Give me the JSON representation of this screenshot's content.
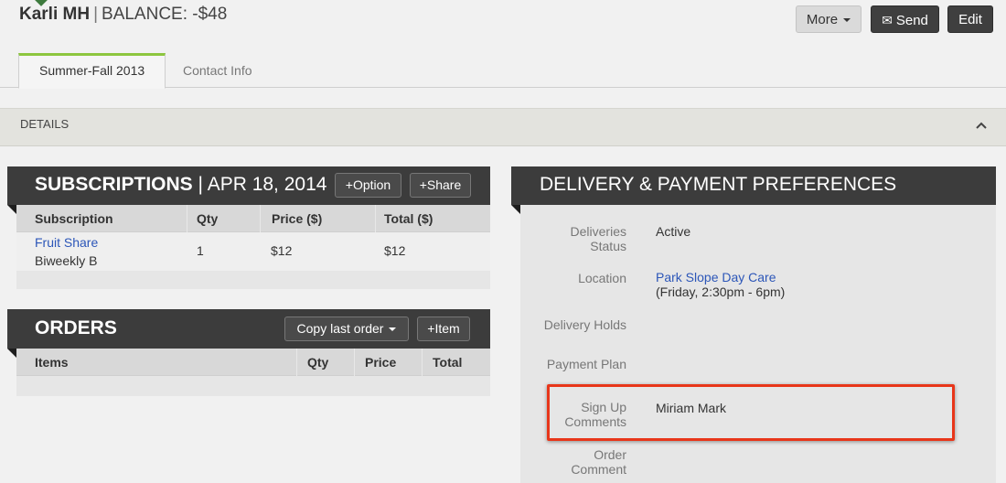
{
  "header": {
    "name": "Karli MH",
    "separator": "|",
    "balance": "BALANCE: -$48",
    "buttons": {
      "more": "More",
      "send": "Send",
      "edit": "Edit"
    }
  },
  "tabs": [
    {
      "label": "Summer-Fall 2013",
      "active": true
    },
    {
      "label": "Contact Info",
      "active": false
    }
  ],
  "details": {
    "label": "DETAILS",
    "icon": "chevron-up-icon"
  },
  "subscriptions": {
    "title": "SUBSCRIPTIONS",
    "separator": "|",
    "date": "APR 18, 2014",
    "option_button": "+Option",
    "share_button": "+Share",
    "columns": [
      "Subscription",
      "Qty",
      "Price ($)",
      "Total ($)"
    ],
    "rows": [
      {
        "name": "Fruit Share",
        "schedule": "Biweekly B",
        "qty": "1",
        "price": "$12",
        "total": "$12"
      }
    ]
  },
  "orders": {
    "title": "ORDERS",
    "copy_button": "Copy last order",
    "item_button": "+Item",
    "columns": [
      "Items",
      "Qty",
      "Price",
      "Total"
    ]
  },
  "preferences": {
    "title": "DELIVERY & PAYMENT PREFERENCES",
    "fields": [
      {
        "label_line1": "Deliveries",
        "label_line2": "Status",
        "value": "Active"
      },
      {
        "label_line1": "Location",
        "value": "Park Slope Day Care",
        "value_line2": "(Friday, 2:30pm - 6pm)"
      },
      {
        "label_line1": "Delivery Holds",
        "value": ""
      },
      {
        "label_line1": "Payment Plan",
        "value": ""
      },
      {
        "label_line1": "Sign Up",
        "label_line2": "Comments",
        "value": "Miriam Mark"
      },
      {
        "label_line1": "Order",
        "label_line2": "Comment",
        "value": ""
      }
    ]
  },
  "colors": {
    "accent_tab": "#8dc63f",
    "link": "#2c56b8",
    "highlight": "#e8361a",
    "panel_header": "#3c3c3c"
  }
}
